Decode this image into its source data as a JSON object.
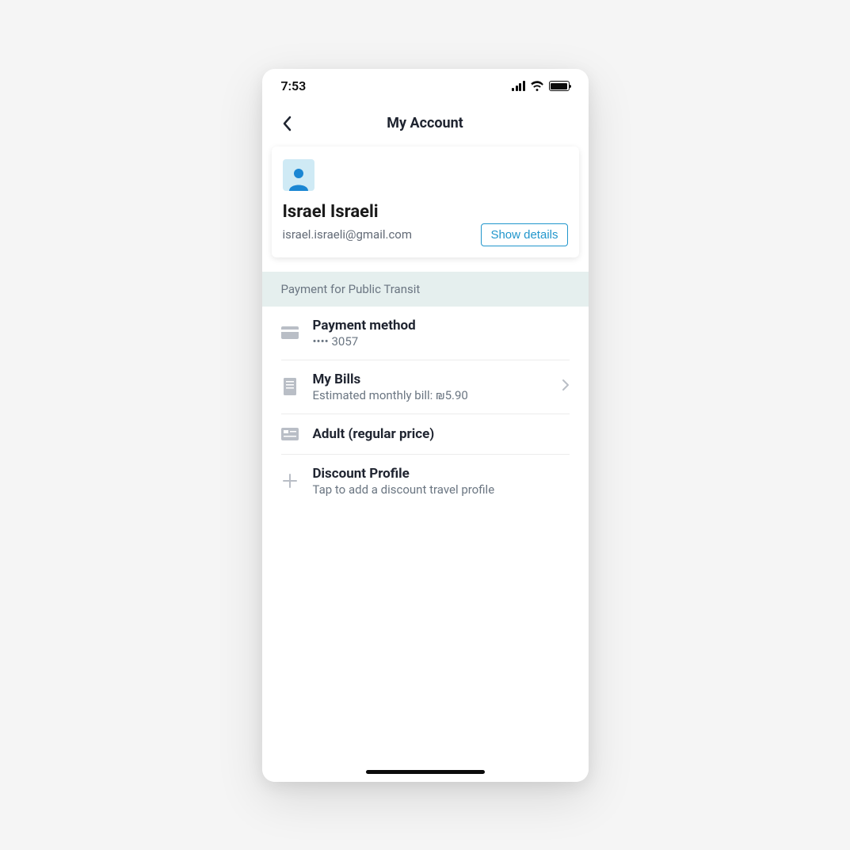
{
  "status_bar": {
    "time": "7:53"
  },
  "nav": {
    "title": "My Account"
  },
  "profile": {
    "name": "Israel Israeli",
    "email": "israel.israeli@gmail.com",
    "show_details_label": "Show details"
  },
  "section": {
    "title": "Payment for Public Transit"
  },
  "items": {
    "payment": {
      "title": "Payment method",
      "subtitle": "•••• 3057"
    },
    "bills": {
      "title": "My Bills",
      "subtitle": "Estimated monthly bill: ₪5.90"
    },
    "fare": {
      "title": "Adult (regular price)"
    },
    "discount": {
      "title": "Discount Profile",
      "subtitle": "Tap to add a discount travel profile"
    }
  }
}
